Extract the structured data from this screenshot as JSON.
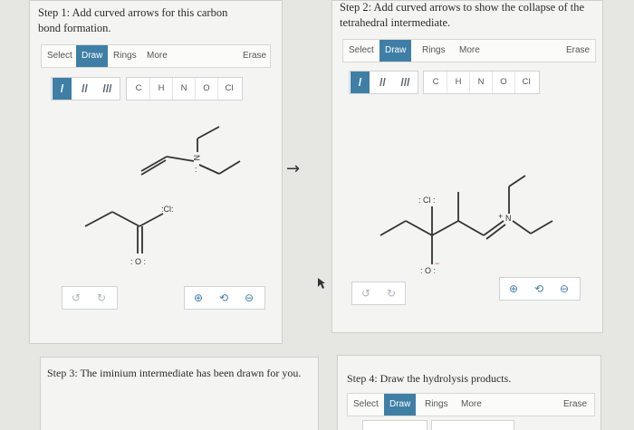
{
  "steps": [
    {
      "title_line1": "Step 1: Add curved arrows for this carbon",
      "title_line2": "bond formation."
    },
    {
      "title_line1": "Step 2: Add curved arrows to show the collapse of the",
      "title_line2": "tetrahedral intermediate."
    },
    {
      "title_line1": "Step 3: The iminium intermediate has been drawn for you."
    },
    {
      "title_line1": "Step 4: Draw the hydrolysis products."
    }
  ],
  "toolbar": {
    "select": "Select",
    "draw": "Draw",
    "rings": "Rings",
    "more": "More",
    "erase": "Erase"
  },
  "bonds": [
    "/",
    "//",
    "///"
  ],
  "atoms": [
    "C",
    "H",
    "N",
    "O",
    "Cl"
  ],
  "controls": {
    "undo": "↺",
    "redo": "↻",
    "zoom_in": "⊕",
    "reset": "⟲",
    "zoom_out": "⊖"
  },
  "molecule_labels": {
    "step1_n": "N",
    "step1_n_lp": ":",
    "step1_cl": ":Cl:",
    "step1_o": ": O :",
    "step2_cl": ": Cl :",
    "step2_n": "N",
    "step2_n_charge": "+",
    "step2_o": ": O :",
    "step2_o_charge": "−"
  },
  "arrow_between": "→",
  "icons": [
    "undo-icon",
    "redo-icon",
    "zoom-in-icon",
    "reset-icon",
    "zoom-out-icon",
    "cursor-icon"
  ],
  "colors": {
    "accent": "#3f7fa6",
    "panel": "#f4f4f2",
    "background": "#e6e6e3"
  }
}
